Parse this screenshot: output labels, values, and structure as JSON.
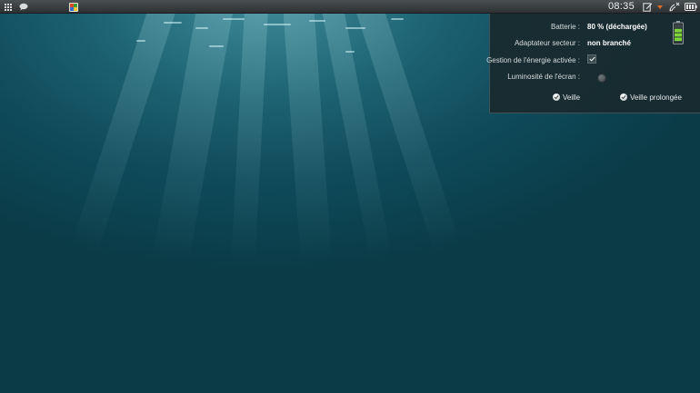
{
  "panel": {
    "clock": "08:35",
    "icons": [
      "app-grid-icon",
      "chat-icon",
      "app-launcher-icon",
      "edit-icon",
      "caret-down-icon",
      "network-signal-icon",
      "battery-icon"
    ]
  },
  "power": {
    "battery_label": "Batterie :",
    "battery_value": "80 % (déchargée)",
    "battery_percent": 80,
    "adapter_label": "Adaptateur secteur :",
    "adapter_value": "non branché",
    "power_management_label": "Gestion de l'énergie activée :",
    "power_management_checked": true,
    "brightness_label": "Luminosité de l'écran :",
    "sleep_label": "Veille",
    "hibernate_label": "Veille prolongée"
  },
  "colors": {
    "battery_fill": "#7dd63a",
    "panel_bg": "#2d3133",
    "popup_bg": "#192a2e"
  }
}
